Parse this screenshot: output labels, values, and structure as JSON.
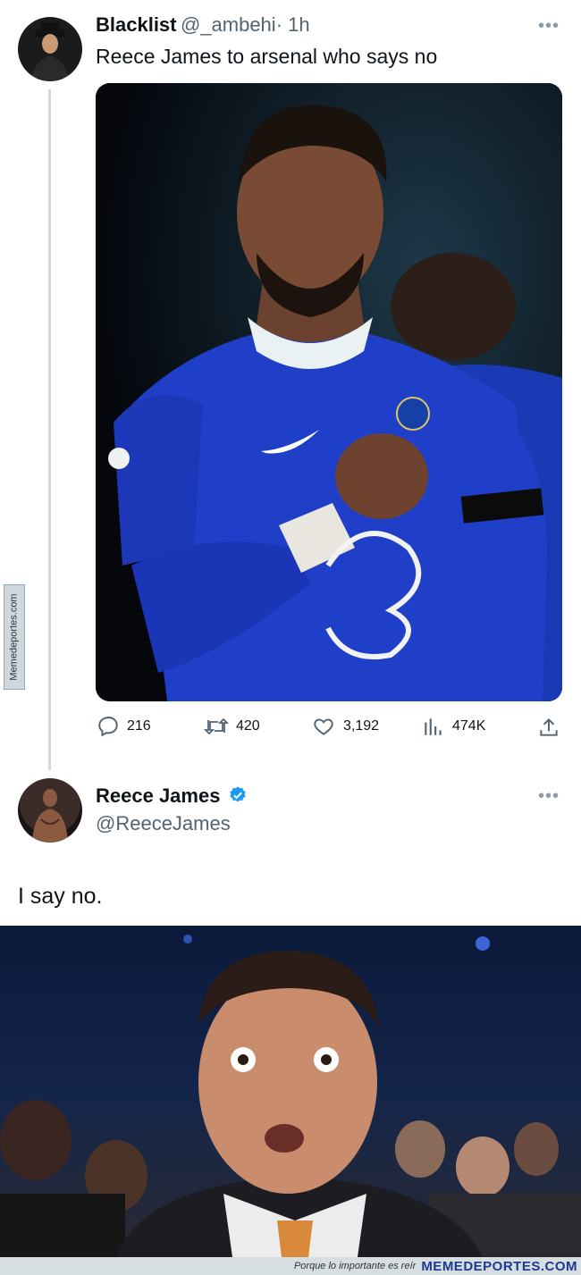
{
  "tweet1": {
    "name": "Blacklist",
    "handle": "@_ambehi",
    "time": "· 1h",
    "text": "Reece James to arsenal who says no",
    "more": "•••",
    "image_alt": "Photo of Chelsea player in blue kit tapping badge",
    "stats": {
      "replies": "216",
      "retweets": "420",
      "likes": "3,192",
      "views": "474K"
    }
  },
  "tweet2": {
    "name": "Reece James",
    "handle": "@ReeceJames",
    "more": "•••",
    "text": "I say no.",
    "image_alt": "Surprised man in suit in crowd"
  },
  "watermark": {
    "side": "Memedeportes.com",
    "slogan": "Porque lo importante es reír",
    "brand": "MEMEDEPORTES.COM"
  },
  "colors": {
    "kit_blue": "#1f3fc8",
    "verified_blue": "#1d9bf0",
    "muted": "#536471"
  }
}
